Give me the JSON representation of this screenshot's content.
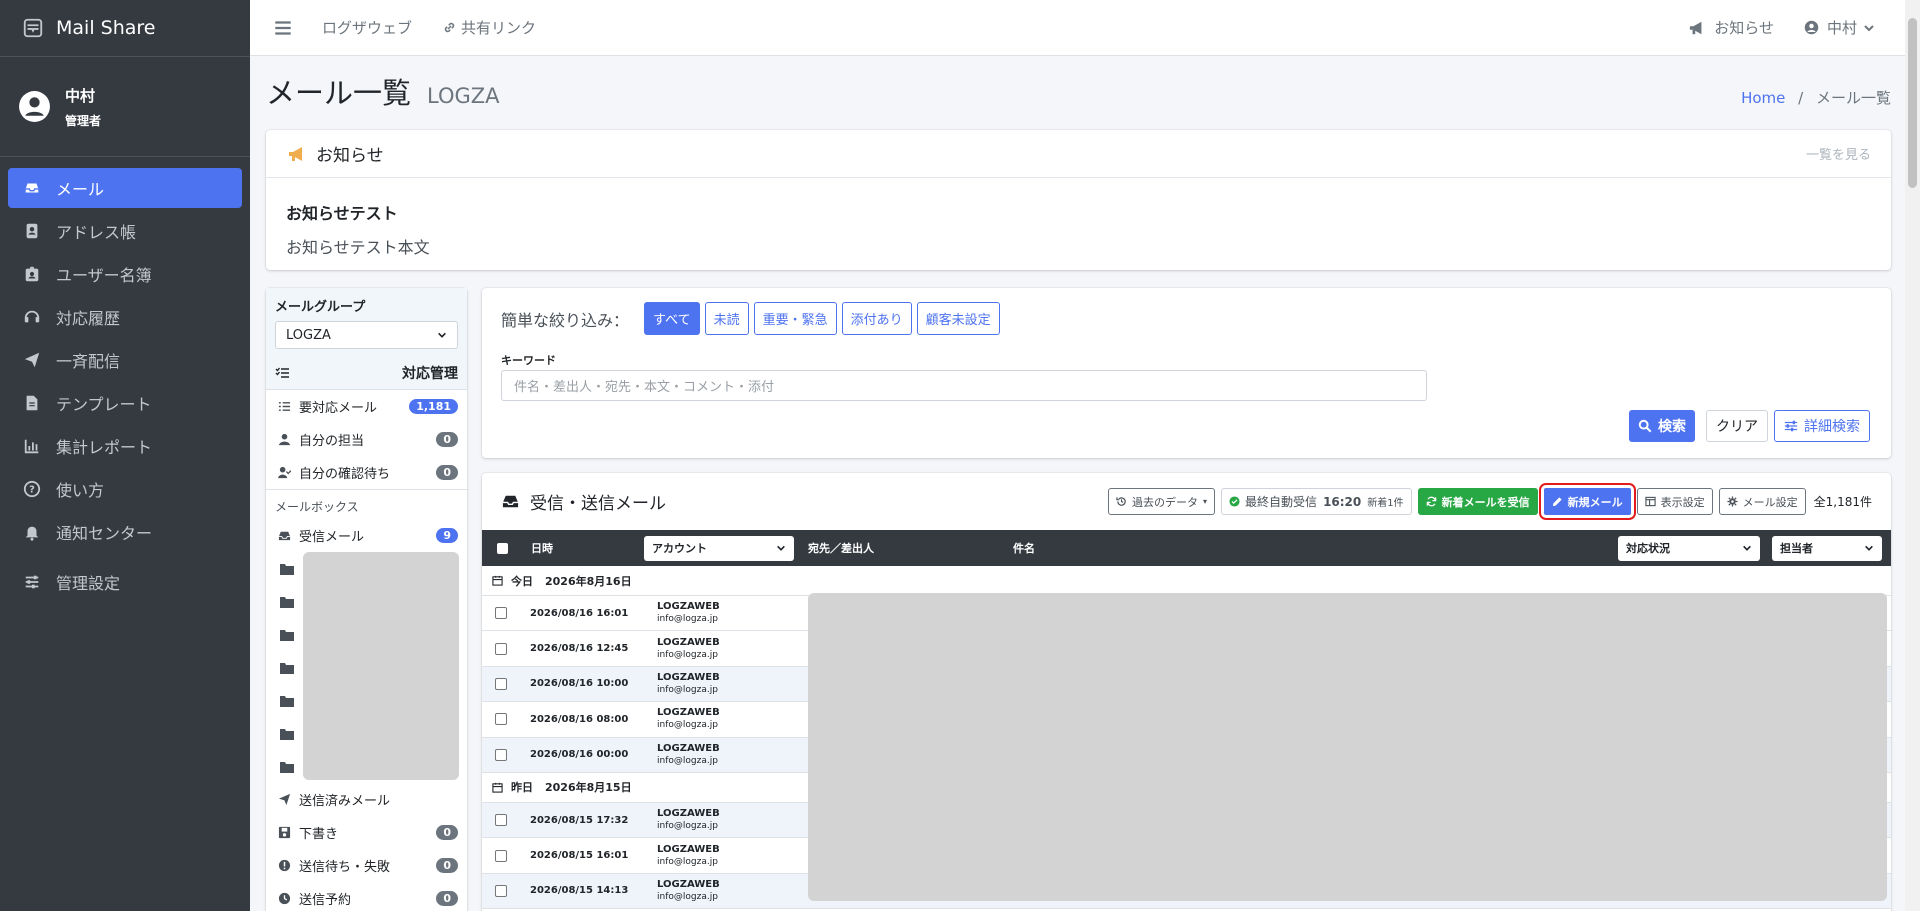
{
  "brand": {
    "title": "Mail Share"
  },
  "user": {
    "name": "中村",
    "role": "管理者"
  },
  "sidebar": {
    "items": [
      {
        "label": "メール",
        "icon": "inbox-icon",
        "active": true
      },
      {
        "label": "アドレス帳",
        "icon": "address-book-icon"
      },
      {
        "label": "ユーザー名簿",
        "icon": "id-badge-icon"
      },
      {
        "label": "対応履歴",
        "icon": "headset-icon"
      },
      {
        "label": "一斉配信",
        "icon": "paper-plane-icon"
      },
      {
        "label": "テンプレート",
        "icon": "file-icon"
      },
      {
        "label": "集計レポート",
        "icon": "chart-icon"
      },
      {
        "label": "使い方",
        "icon": "question-icon"
      },
      {
        "label": "通知センター",
        "icon": "bell-icon"
      },
      {
        "label": "管理設定",
        "icon": "sliders-icon"
      }
    ]
  },
  "topbar": {
    "link1": "ログザウェブ",
    "link2": "共有リンク",
    "notice": "お知らせ",
    "user": "中村"
  },
  "header": {
    "title": "メール一覧",
    "subtitle": "LOGZA",
    "breadcrumb_home": "Home",
    "breadcrumb_sep": "/",
    "breadcrumb_current": "メール一覧"
  },
  "notice_card": {
    "title": "お知らせ",
    "more": "一覧を見る",
    "item_title": "お知らせテスト",
    "item_body": "お知らせテスト本文"
  },
  "left_panel": {
    "group_label": "メールグループ",
    "group_value": "LOGZA",
    "manage_label": "対応管理",
    "manage_items": [
      {
        "label": "要対応メール",
        "count": "1,181",
        "badge": "primary"
      },
      {
        "label": "自分の担当",
        "count": "0",
        "badge": "secondary"
      },
      {
        "label": "自分の確認待ち",
        "count": "0",
        "badge": "secondary"
      }
    ],
    "mailbox_label": "メールボックス",
    "inbox": {
      "label": "受信メール",
      "count": "9"
    },
    "outbox_items": [
      {
        "label": "送信済みメール",
        "count": ""
      },
      {
        "label": "下書き",
        "count": "0"
      },
      {
        "label": "送信待ち・失敗",
        "count": "0"
      },
      {
        "label": "送信予約",
        "count": "0"
      }
    ]
  },
  "filter": {
    "quick_label": "簡単な絞り込み：",
    "quick_buttons": [
      "すべて",
      "未読",
      "重要・緊急",
      "添付あり",
      "顧客未設定"
    ],
    "keyword_label": "キーワード",
    "keyword_placeholder": "件名・差出人・宛先・本文・コメント・添付",
    "search": "検索",
    "clear": "クリア",
    "advanced": "詳細検索"
  },
  "mail_list": {
    "title": "受信・送信メール",
    "past_data": "過去のデータ",
    "last_auto": "最終自動受信",
    "last_time": "16:20",
    "new_count": "新着1件",
    "receive_btn": "新着メールを受信",
    "compose_btn": "新規メール",
    "display_settings": "表示設定",
    "mail_settings": "メール設定",
    "total": "全1,181件",
    "columns": {
      "date": "日時",
      "account": "アカウント",
      "to_from": "宛先／差出人",
      "subject": "件名",
      "status": "対応状況",
      "assignee": "担当者"
    },
    "groups": [
      {
        "label": "今日",
        "date": "2026年8月16日",
        "rows": [
          {
            "datetime": "2026/08/16 16:01",
            "account": "LOGZAWEB",
            "email": "info@logza.jp"
          },
          {
            "datetime": "2026/08/16 12:45",
            "account": "LOGZAWEB",
            "email": "info@logza.jp"
          },
          {
            "datetime": "2026/08/16 10:00",
            "account": "LOGZAWEB",
            "email": "info@logza.jp"
          },
          {
            "datetime": "2026/08/16 08:00",
            "account": "LOGZAWEB",
            "email": "info@logza.jp"
          },
          {
            "datetime": "2026/08/16 00:00",
            "account": "LOGZAWEB",
            "email": "info@logza.jp"
          }
        ]
      },
      {
        "label": "昨日",
        "date": "2026年8月15日",
        "rows": [
          {
            "datetime": "2026/08/15 17:32",
            "account": "LOGZAWEB",
            "email": "info@logza.jp"
          },
          {
            "datetime": "2026/08/15 16:01",
            "account": "LOGZAWEB",
            "email": "info@logza.jp"
          },
          {
            "datetime": "2026/08/15 14:13",
            "account": "LOGZAWEB",
            "email": "info@logza.jp"
          }
        ]
      }
    ]
  }
}
